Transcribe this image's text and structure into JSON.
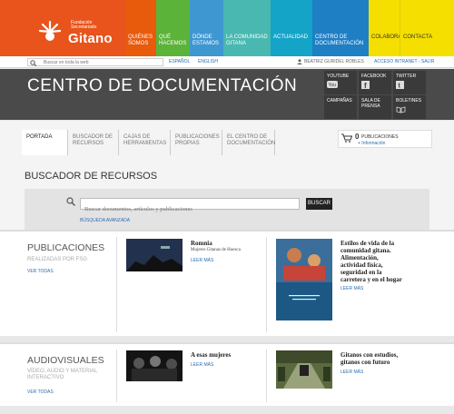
{
  "logo": {
    "small_line1": "Fundación",
    "small_line2": "Secretariado",
    "big": "Gitano"
  },
  "nav": {
    "quienes": [
      "QUIÉNES",
      "SOMOS"
    ],
    "que": [
      "QUÉ",
      "HACEMOS"
    ],
    "donde": [
      "DÓNDE",
      "ESTAMOS"
    ],
    "comunidad": [
      "LA COMUNIDAD",
      "GITANA"
    ],
    "actualidad": [
      "ACTUALIDAD"
    ],
    "centro": [
      "CENTRO DE",
      "DOCUMENTACIÓN"
    ],
    "colabora": [
      "COLABORA"
    ],
    "contacta": [
      "CONTACTA"
    ]
  },
  "topbar": {
    "search_placeholder": "Buscar en toda la web",
    "lang_es": "ESPAÑOL",
    "lang_en": "ENGLISH",
    "user": "BEATRIZ GURIDEL ROBLES",
    "access": "ACCESO INTRANET - SALIR"
  },
  "header": {
    "title": "CENTRO DE DOCUMENTACIÓN"
  },
  "social": {
    "youtube": "YOUTUBE",
    "facebook": "FACEBOOK",
    "twitter": "TWITTER",
    "campanas": "CAMPAÑAS",
    "sala1": "SALA DE",
    "sala2": "PRENSA",
    "boletines": "BOLETINES"
  },
  "subnav": {
    "portada": [
      "PORTADA"
    ],
    "buscador": [
      "BUSCADOR DE",
      "RECURSOS"
    ],
    "cajas": [
      "CAJAS DE",
      "HERRAMIENTAS"
    ],
    "publicaciones": [
      "PUBLICACIONES",
      "PROPIAS"
    ],
    "centro": [
      "EL CENTRO DE",
      "DOCUMENTACIÓN"
    ]
  },
  "cart": {
    "count": "0",
    "label": "PUBLICACIONES",
    "info": "+ Información"
  },
  "buscador": {
    "title": "BUSCADOR DE RECURSOS",
    "placeholder": "Buscar documentos, artículos y publicaciones",
    "button": "BUSCAR",
    "advanced": "BÚSQUEDA AVANZADA"
  },
  "publicaciones": {
    "title": "PUBLICACIONES",
    "sub": "REALIZADAS POR FSG",
    "link": "VER TODAS",
    "item1_title": "Romnia",
    "item1_sub": "Mujeres Gitanas de Huesca",
    "item1_more": "LEER MÁS",
    "item2_title": [
      "Estilos de vida de la",
      "comunidad gitana.",
      "Alimentación,",
      "actividad física,",
      "seguridad en la",
      "carretera y en el hogar"
    ],
    "item2_more": "LEER MÁS"
  },
  "audiovisuales": {
    "title": "AUDIOVISUALES",
    "sub1": "VÍDEO, AUDIO Y MATERIAL",
    "sub2": "INTERACTIVO",
    "link": "VER TODAS",
    "item1_title": "A esas mujeres",
    "item1_more": "LEER MÁS",
    "item2_title": [
      "Gitanos con estudios,",
      "gitanos con futuro"
    ],
    "item2_more": "LEER MÁS"
  },
  "colors": {
    "orange": "#e8541c",
    "green": "#5bb33a",
    "blue": "#3f97d2",
    "teal": "#49b8b0",
    "cyan": "#14a4c8",
    "darkblue": "#1f7fc5",
    "yellow": "#f4df00",
    "dark": "#4a4a4a",
    "link": "#2a6fb0"
  }
}
